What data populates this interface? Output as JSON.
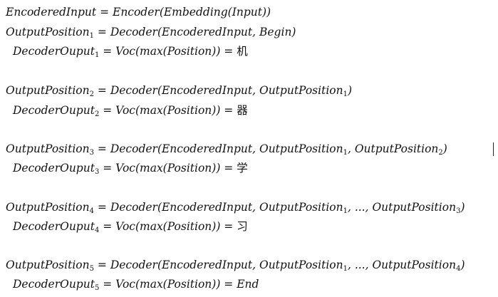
{
  "equations": [
    {
      "lhs": "EncoderedInput",
      "sub": "",
      "op": " = ",
      "rhs": "Encoder(Embedding(Input))",
      "rhs_tail": "",
      "rhs_sub": "",
      "rhs_end": "",
      "result": ""
    },
    {
      "lhs": "OutputPosition",
      "sub": "1",
      "op": " = ",
      "rhs": "Decoder(EncoderedInput, Begin)",
      "rhs_tail": "",
      "rhs_sub": "",
      "rhs_end": "",
      "result": ""
    },
    {
      "lhs": "DecoderOuput",
      "sub": "1",
      "op": " = ",
      "rhs": "Voc(max(Position)) = ",
      "rhs_tail": "",
      "rhs_sub": "",
      "rhs_end": "",
      "result": "机"
    },
    {
      "lhs": "OutputPosition",
      "sub": "2",
      "op": " = ",
      "rhs": "Decoder(EncoderedInput, OutputPosition",
      "rhs_tail": "",
      "rhs_sub": "1",
      "rhs_end": ")",
      "result": ""
    },
    {
      "lhs": "DecoderOuput",
      "sub": "2",
      "op": " = ",
      "rhs": "Voc(max(Position)) = ",
      "rhs_tail": "",
      "rhs_sub": "",
      "rhs_end": "",
      "result": "器"
    },
    {
      "lhs": "OutputPosition",
      "sub": "3",
      "op": " = ",
      "rhs": "Decoder(EncoderedInput, OutputPosition",
      "rhs_tail": "",
      "rhs_sub": "1",
      "rhs_end": ", OutputPosition",
      "rhs_sub2": "2",
      "rhs_end2": ")",
      "result": ""
    },
    {
      "lhs": "DecoderOuput",
      "sub": "3",
      "op": " = ",
      "rhs": "Voc(max(Position)) = ",
      "rhs_tail": "",
      "rhs_sub": "",
      "rhs_end": "",
      "result": "学"
    },
    {
      "lhs": "OutputPosition",
      "sub": "4",
      "op": " = ",
      "rhs": "Decoder(EncoderedInput, OutputPosition",
      "rhs_tail": "",
      "rhs_sub": "1",
      "rhs_end": ", ..., OutputPosition",
      "rhs_sub2": "3",
      "rhs_end2": ")",
      "result": ""
    },
    {
      "lhs": "DecoderOuput",
      "sub": "4",
      "op": " = ",
      "rhs": "Voc(max(Position)) = ",
      "rhs_tail": "",
      "rhs_sub": "",
      "rhs_end": "",
      "result": "习"
    },
    {
      "lhs": "OutputPosition",
      "sub": "5",
      "op": " = ",
      "rhs": "Decoder(EncoderedInput, OutputPosition",
      "rhs_tail": "",
      "rhs_sub": "1",
      "rhs_end": ", ..., OutputPosition",
      "rhs_sub2": "4",
      "rhs_end2": ")",
      "result": ""
    },
    {
      "lhs": "DecoderOuput",
      "sub": "5",
      "op": " = ",
      "rhs": "Voc(max(Position)) = End",
      "rhs_tail": "",
      "rhs_sub": "",
      "rhs_end": "",
      "result": ""
    }
  ]
}
